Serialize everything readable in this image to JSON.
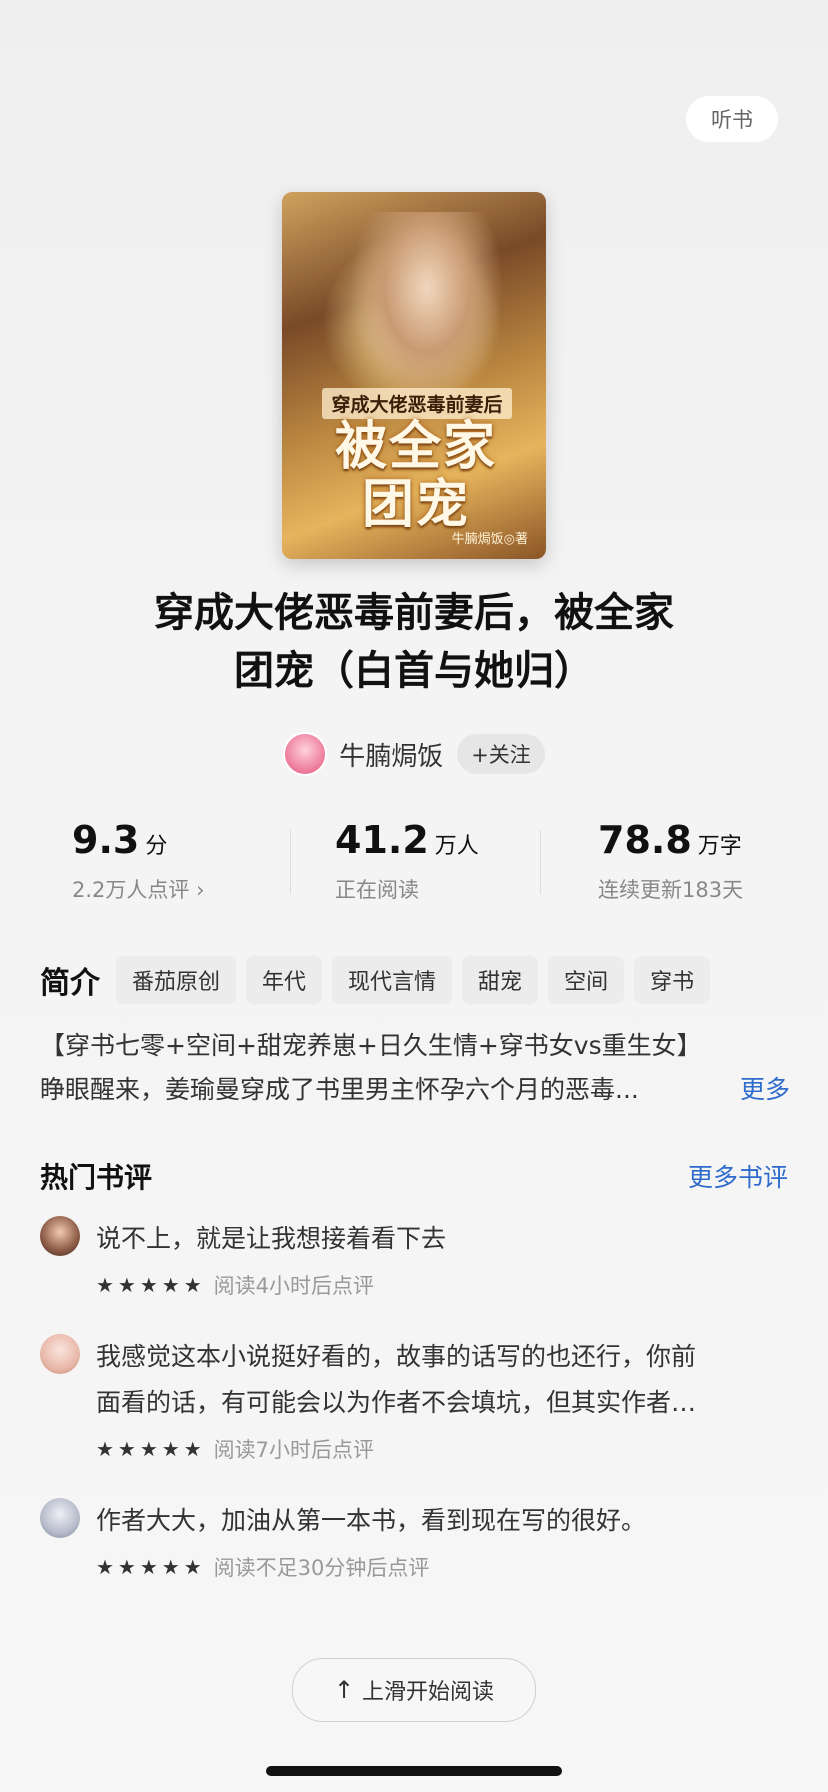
{
  "header": {
    "listen_label": "听书"
  },
  "book": {
    "cover_subtitle": "穿成大佬恶毒前妻后",
    "cover_title_line1": "被全家",
    "cover_title_line2": "团宠",
    "cover_author": "牛腩焗饭◎著",
    "title_line1": "穿成大佬恶毒前妻后，被全家",
    "title_line2": "团宠（白首与她归）"
  },
  "author": {
    "name": "牛腩焗饭",
    "follow_label": "+关注"
  },
  "stats": [
    {
      "value": "9.3",
      "unit": "分",
      "sub": "2.2万人点评 ›"
    },
    {
      "value": "41.2",
      "unit": "万人",
      "sub": "正在阅读"
    },
    {
      "value": "78.8",
      "unit": "万字",
      "sub": "连续更新183天"
    }
  ],
  "intro": {
    "label": "简介",
    "tags": [
      "番茄原创",
      "年代",
      "现代言情",
      "甜宠",
      "空间",
      "穿书"
    ],
    "line1": "【穿书七零+空间+甜宠养崽+日久生情+穿书女vs重生女】",
    "line2": "睁眼醒来，姜瑜曼穿成了书里男主怀孕六个月的恶毒...",
    "more_label": "更多"
  },
  "reviews": {
    "title": "热门书评",
    "more_label": "更多书评",
    "items": [
      {
        "text": "说不上，就是让我想接着看下去",
        "stars": "★★★★★",
        "meta": "阅读4小时后点评"
      },
      {
        "text1": "我感觉这本小说挺好看的，故事的话写的也还行，你前",
        "text2": "面看的话，有可能会以为作者不会填坑，但其实作者…",
        "stars": "★★★★★",
        "meta": "阅读7小时后点评"
      },
      {
        "text": "作者大大，加油从第一本书，看到现在写的很好。",
        "stars": "★★★★★",
        "meta": "阅读不足30分钟后点评"
      }
    ]
  },
  "footer": {
    "slide_label": "上滑开始阅读",
    "arrow_icon": "arrow-up-icon"
  }
}
